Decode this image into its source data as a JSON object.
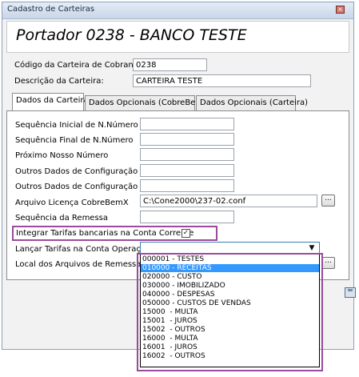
{
  "window": {
    "title": "Cadastro de Carteiras",
    "close_glyph": "×"
  },
  "header": {
    "title": "Portador 0238 - BANCO TESTE"
  },
  "top_fields": {
    "codigo_label": "Código da Carteira de Cobrança:",
    "codigo_value": "0238",
    "descricao_label": "Descrição da Carteira:",
    "descricao_value": "CARTEIRA TESTE"
  },
  "tabs": [
    {
      "label": "Dados da Carteira",
      "active": true
    },
    {
      "label": "Dados Opcionais (CobreBemX)",
      "active": false
    },
    {
      "label": "Dados Opcionais (Carteira)",
      "active": false
    }
  ],
  "form": {
    "seq_inicial_label": "Sequência Inicial de N.Número",
    "seq_inicial_value": "",
    "seq_final_label": "Sequência Final de N.Número",
    "seq_final_value": "",
    "proximo_label": "Próximo Nosso Número",
    "proximo_value": "",
    "outros1_label": "Outros Dados de Configuração 1",
    "outros1_value": "",
    "outros2_label": "Outros Dados de Configuração 2",
    "outros2_value": "",
    "arquivo_label": "Arquivo Licença CobreBemX",
    "arquivo_value": "C:\\Cone2000\\237-02.conf",
    "arquivo_btn": "...",
    "seq_remessa_label": "Sequência da Remessa",
    "seq_remessa_value": "",
    "integrar_label": "Integrar Tarifas bancarias na Conta Corrente",
    "integrar_checked": true,
    "integrar_check_glyph": "✓",
    "lancar_label": "Lançar Tarifas na Conta Operação:",
    "lancar_value": "",
    "lancar_arrow": "▼",
    "local_label": "Local dos Arquivos de Remessa:",
    "local_btn": "..."
  },
  "dropdown": {
    "selected_index": 1,
    "options": [
      "000001 - TESTES",
      "010000 - RECEITAS",
      "020000 - CUSTO",
      "030000 - IMOBILIZADO",
      "040000 - DESPESAS",
      "050000 - CUSTOS DE VENDAS",
      "15000  - MULTA",
      "15001  - JUROS",
      "15002  - OUTROS",
      "16000  - MULTA",
      "16001  - JUROS",
      "16002  - OUTROS"
    ]
  },
  "icons": {
    "save": "floppy-disk-icon"
  },
  "colors": {
    "highlight": "#9b4a9c",
    "selection": "#3399ff",
    "combo_border": "#3c7fb1"
  }
}
